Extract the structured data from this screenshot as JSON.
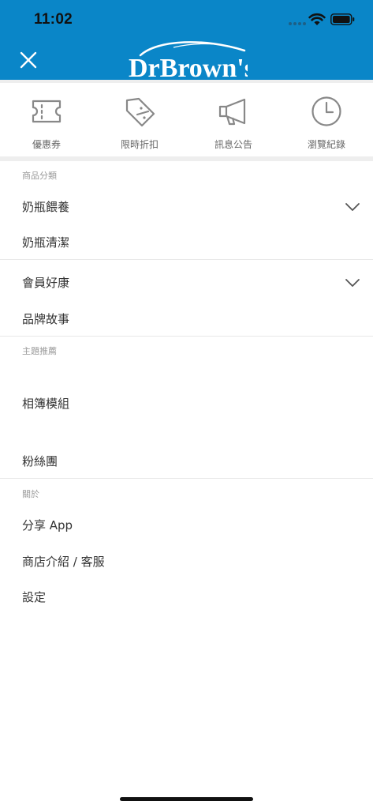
{
  "status_bar": {
    "time": "11:02"
  },
  "header": {
    "background_color": "#0a86c8",
    "logo_text": "DrBrown's"
  },
  "quick_links": [
    {
      "label": "優惠券",
      "icon": "ticket-icon"
    },
    {
      "label": "限時折扣",
      "icon": "tag-discount-icon"
    },
    {
      "label": "訊息公告",
      "icon": "megaphone-icon"
    },
    {
      "label": "瀏覽紀錄",
      "icon": "clock-icon"
    }
  ],
  "sections": {
    "categories": {
      "title": "商品分類",
      "items": [
        "奶瓶餵養",
        "奶瓶清潔"
      ]
    },
    "member": {
      "items": [
        "會員好康",
        "品牌故事"
      ]
    },
    "themes": {
      "title": "主題推薦",
      "items": [
        "相簿模組",
        "粉絲團"
      ]
    },
    "about": {
      "title": "關於",
      "items": [
        "分享 App",
        "商店介紹 / 客服",
        "設定"
      ]
    }
  }
}
